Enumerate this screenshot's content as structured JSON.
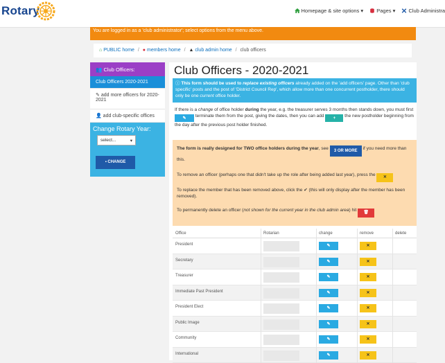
{
  "brand": {
    "name": "Rotary"
  },
  "nav": {
    "items": [
      {
        "label": "Homepage & site options ▾",
        "icon": "home-icon",
        "color": "#2e9e3e"
      },
      {
        "label": "Pages ▾",
        "icon": "database-icon",
        "color": "#d62e3e"
      },
      {
        "label": "Club Administra",
        "icon": "wrench-icon",
        "color": "#1f5aa8"
      }
    ]
  },
  "banner": {
    "text": "You are logged in as a 'club administrator'; select options from the menu above."
  },
  "breadcrumb": {
    "home": "PUBLIC home",
    "members": "members home",
    "admin": "club admin home",
    "current": "club officers"
  },
  "sidebar": {
    "header": "Club Officers:",
    "items": [
      {
        "label": "Club Officers 2020-2021"
      },
      {
        "label": "add more officers for 2020-2021"
      },
      {
        "label": "add club-specific offices"
      }
    ],
    "rotary_label": "Change Rotary Year:",
    "select_value": "select...",
    "change_button": "CHANGE"
  },
  "main": {
    "title": "Club Officers - 2020-2021",
    "info": {
      "pre": "This form should be used to ",
      "emph": "replace existing officers",
      "post": " already added on the 'add officers' page. Other than 'club specific' posts and the post of 'District Council Rep', which allow more than one concurrent postholder, there should only be one ",
      "emph2": "current",
      "post2": " office holder."
    },
    "para1": {
      "a": "If there is a ",
      "b": "change",
      "c": " of office holder ",
      "d": "during",
      "e": " the year, e.g. the treasurer serves 3 months then stands down, you must first ",
      "f": " terminate them from the post, giving the dates, then you can add ",
      "g": " the new postholder beginning from the day after the previous post holder finished."
    },
    "note": {
      "n1a": "The form is really designed for TWO office holders during the year",
      "n1b": ", see ",
      "n1btn": "3 OR MORE",
      "n1c": " if you need more than this.",
      "n2": "To remove an officer (perhaps one that didn't take up the role after being added last year), press the ",
      "n3a": "To replace the member that has been removed above, click the ",
      "n3b": " (this will only display after the member has been removed).",
      "n4a": "To permanently delete an officer (",
      "n4b": "not shown for the current year in the club admin area",
      "n4c": ") hit"
    },
    "table": {
      "headers": [
        "Office",
        "Rotarian",
        "change",
        "remove",
        "delete"
      ],
      "rows": [
        {
          "office": "President"
        },
        {
          "office": "Secretary"
        },
        {
          "office": "Treasurer"
        },
        {
          "office": "Immediate Past President"
        },
        {
          "office": "President Elect"
        },
        {
          "office": "Public Image"
        },
        {
          "office": "Community"
        },
        {
          "office": "International"
        }
      ]
    }
  }
}
